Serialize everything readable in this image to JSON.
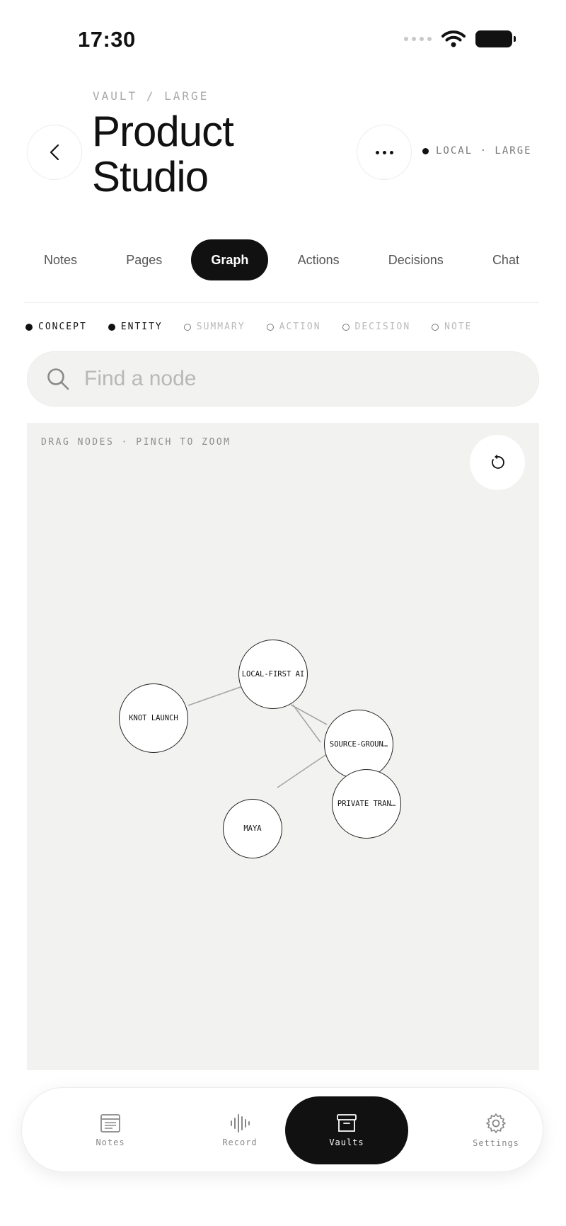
{
  "status_bar": {
    "time": "17:30"
  },
  "header": {
    "breadcrumb": "VAULT / LARGE",
    "title": "Product Studio",
    "badge_text": "LOCAL · LARGE"
  },
  "tabs": [
    {
      "label": "Notes",
      "active": false
    },
    {
      "label": "Pages",
      "active": false
    },
    {
      "label": "Graph",
      "active": true
    },
    {
      "label": "Actions",
      "active": false
    },
    {
      "label": "Decisions",
      "active": false
    },
    {
      "label": "Chat",
      "active": false
    }
  ],
  "legend": [
    {
      "label": "CONCEPT",
      "enabled": true
    },
    {
      "label": "ENTITY",
      "enabled": true
    },
    {
      "label": "SUMMARY",
      "enabled": false
    },
    {
      "label": "ACTION",
      "enabled": false
    },
    {
      "label": "DECISION",
      "enabled": false
    },
    {
      "label": "NOTE",
      "enabled": false
    }
  ],
  "search": {
    "placeholder": "Find a node",
    "value": ""
  },
  "graph": {
    "hint": "DRAG NODES · PINCH TO ZOOM",
    "nodes": [
      {
        "id": "local-first-ai",
        "label": "LOCAL-FIRST AI"
      },
      {
        "id": "knot-launch",
        "label": "KNOT LAUNCH"
      },
      {
        "id": "source-grounded",
        "label": "SOURCE-GROUN…"
      },
      {
        "id": "private-transcription",
        "label": "PRIVATE TRAN…"
      },
      {
        "id": "maya",
        "label": "MAYA"
      }
    ],
    "edges": [
      [
        "knot-launch",
        "local-first-ai"
      ],
      [
        "local-first-ai",
        "source-grounded"
      ],
      [
        "local-first-ai",
        "private-transcription"
      ],
      [
        "maya",
        "source-grounded"
      ]
    ]
  },
  "bottom_nav": [
    {
      "label": "Notes",
      "icon": "notes-icon",
      "active": false
    },
    {
      "label": "Record",
      "icon": "waveform-icon",
      "active": false
    },
    {
      "label": "Vaults",
      "icon": "archive-box-icon",
      "active": true
    },
    {
      "label": "Settings",
      "icon": "gear-icon",
      "active": false
    }
  ]
}
